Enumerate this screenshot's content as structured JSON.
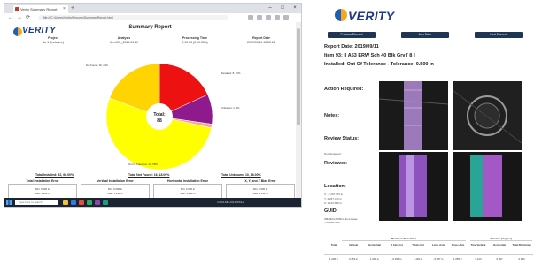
{
  "browser": {
    "tab_title": "Verity Summary Report",
    "url": "file:///C:/Users/Verity/Reports/SummaryReport.html",
    "new_tab": "+",
    "tab_close": "×",
    "nav": {
      "back": "←",
      "forward": "→",
      "refresh": "⟳"
    },
    "window": {
      "minimize": "–",
      "maximize": "□",
      "close": "×"
    },
    "taskbar_search": "Type here to search",
    "tray_time": "10:25 AM  2019/09/11"
  },
  "left_report": {
    "logo_text": "VERITY",
    "title": "Summary Report",
    "meta": [
      {
        "label": "Project",
        "value": "No 1 (Inclusive)"
      },
      {
        "label": "Analysis",
        "value": "Item001_2019.09.11"
      },
      {
        "label": "Processing Time",
        "value": "0:10:33 (0:10:33 s)"
      },
      {
        "label": "Report Date",
        "value": "2019/09/11 10:22:28"
      }
    ],
    "chart_data": {
      "type": "pie",
      "title": "",
      "center_label": "Total:",
      "center_value": "88",
      "series": [
        {
          "name": "Not Found: 16, 18%",
          "value": 16,
          "color": "#ee1111"
        },
        {
          "name": "Deviated: 8, 10%",
          "value": 8,
          "color": "#8e1a8e"
        },
        {
          "name": "Unknown: 1, 1%",
          "value": 1,
          "color": "#f4a6a6"
        },
        {
          "name": "Out Of Tolerance: 46, 58%",
          "value": 46,
          "color": "#ffff00"
        },
        {
          "name": "In Tolerance: 17, 13%",
          "value": 17,
          "color": "#ffd400"
        }
      ]
    },
    "totals": [
      "Total Installed: 62, 66.00%",
      "Total Not Found: 16, 18.00%",
      "Total Unknown: 10, 16.00%"
    ],
    "error_boxes": [
      {
        "title": "Total Installation Error",
        "rows": [
          "Min: 0.000 in",
          "Max: 1.234 in"
        ]
      },
      {
        "title": "Vertical Installation Error",
        "rows": [
          "Min: 0.000 in",
          "Max: 1.234 in"
        ]
      },
      {
        "title": "Horizontal Installation Error",
        "rows": [
          "Min: 0.000 in",
          "Max: 1.234 in"
        ]
      },
      {
        "title": "X, Y, and Z Bias Error",
        "rows": [
          "Min: 0.000 in",
          "Max: 1.234 in"
        ]
      }
    ]
  },
  "right_report": {
    "logo_text": "VERITY",
    "buttons": [
      "Previous Element",
      "Item Table",
      "Next Element"
    ],
    "report_date": "Report Date: 2019/09/11",
    "item": "Item 93: || A53 ERW Sch 40 Blk Grv [ 8 ]",
    "installed": "Installed: Out Of Tolerance - Tolerance: 0.500 in",
    "sections": {
      "action_required": "Action Required:",
      "notes": "Notes:",
      "review_status": "Review Status:",
      "review_status_value": "Not Reviewed",
      "reviewer": "Reviewer:",
      "location": "Location:",
      "location_values": [
        "X: -2,307.376 in",
        "Y: 4,267.470 in",
        "Z: 1,146.808 in"
      ],
      "guid": "GUID:",
      "guid_value": "3f8d0b6e7-86b4-4bce-8aaa-cc9f08f3c9d9"
    },
    "table": {
      "group_headers": [
        "Maximum Translation",
        "Rotation (degrees)"
      ],
      "columns": [
        "Total",
        "Vertical",
        "Horizontal",
        "X Axis (in)",
        "Y Axis (in)",
        "Long. Axis",
        "Cross Axis",
        "True Vertical",
        "Horizontal",
        "Total (Rot/Axial)"
      ],
      "row": [
        "1.205 in",
        "0.453 in",
        "1.000 in",
        "-0.396 in",
        "1.145 in",
        "-0.987 in",
        "1.055 in",
        "0.123",
        "0.897",
        "0.900"
      ]
    }
  }
}
